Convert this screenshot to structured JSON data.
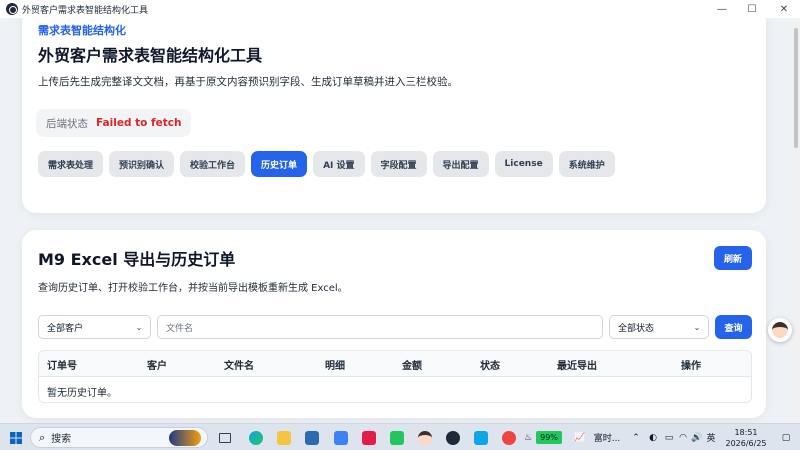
{
  "window": {
    "title": "外贸客户需求表智能结构化工具"
  },
  "hero": {
    "eyebrow": "需求表智能结构化",
    "title": "外贸客户需求表智能结构化工具",
    "description": "上传后先生成完整译文文档，再基于原文内容预识别字段、生成订单草稿并进入三栏校验。",
    "backend_status_label": "后端状态",
    "backend_status_value": "Failed to fetch"
  },
  "tabs": [
    {
      "label": "需求表处理",
      "active": false
    },
    {
      "label": "预识别确认",
      "active": false
    },
    {
      "label": "校验工作台",
      "active": false
    },
    {
      "label": "历史订单",
      "active": true
    },
    {
      "label": "AI 设置",
      "active": false
    },
    {
      "label": "字段配置",
      "active": false
    },
    {
      "label": "导出配置",
      "active": false
    },
    {
      "label": "License",
      "active": false
    },
    {
      "label": "系统维护",
      "active": false
    }
  ],
  "history": {
    "title": "M9 Excel 导出与历史订单",
    "description": "查询历史订单、打开校验工作台，并按当前导出模板重新生成 Excel。",
    "refresh_label": "刷新",
    "filters": {
      "customer_select": "全部客户",
      "filename_placeholder": "文件名",
      "status_select": "全部状态",
      "query_label": "查询"
    },
    "columns": [
      "订单号",
      "客户",
      "文件名",
      "明细",
      "金额",
      "状态",
      "最近导出",
      "操作"
    ],
    "empty_text": "暂无历史订单。"
  },
  "taskbar": {
    "search_label": "搜索",
    "battery": "99%",
    "weather_text": "富时...",
    "ime": "英",
    "time": "18:51",
    "date": "2026/6/25"
  },
  "colors": {
    "accent": "#2563eb",
    "error": "#dc2626",
    "background": "#eef1f5"
  }
}
